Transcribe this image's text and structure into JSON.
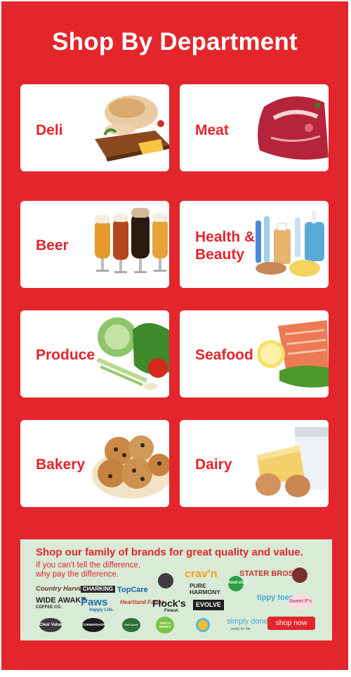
{
  "title": "Shop By Department",
  "departments": [
    {
      "label": "Deli",
      "icon": "deli-meat-icon"
    },
    {
      "label": "Meat",
      "icon": "steak-icon"
    },
    {
      "label": "Beer",
      "icon": "beer-glasses-icon"
    },
    {
      "label": "Health & Beauty",
      "icon": "toiletries-icon"
    },
    {
      "label": "Produce",
      "icon": "vegetables-icon"
    },
    {
      "label": "Seafood",
      "icon": "salmon-icon"
    },
    {
      "label": "Bakery",
      "icon": "cookies-icon"
    },
    {
      "label": "Dairy",
      "icon": "milk-cheese-eggs-icon"
    }
  ],
  "brands": {
    "headline": "Shop our family of brands for great quality and value.",
    "subtext": "If you can't tell the difference, why pay the difference.",
    "logos": {
      "country_harvest": "Country Harvest",
      "charking": "CHARKING",
      "topcare": "TopCare",
      "culinary_tours": "CULINARY TOURS",
      "cravn": "crav'n",
      "stater_bros": "STATER BROS.",
      "over_the_top": "over the top",
      "wide_awake": "WIDE AWAKE",
      "wide_awake_sub": "COFFEE CO.",
      "paws": "Paws",
      "paws_sub": "Happy Life.",
      "heartland": "Heartland Farms",
      "pure_harmony": "PURE HARMONY",
      "flocks": "Flock's",
      "flocks_sub": "Finest.",
      "evolve": "EVOLVE",
      "food_club": "food club",
      "tippy_toes": "tippy toes",
      "sweet_p": "Sweet P's",
      "clear_value": "Clear Value",
      "cornershop": "CORNERSHOP",
      "full_circle": "Full Circle",
      "thats_smart": "THAT'S SMART!",
      "simply_done": "simply done",
      "simply_done_sub": "ready for life"
    },
    "cta": "shop now"
  },
  "colors": {
    "brand_red": "#e2262c",
    "brand_band": "#d9ead7"
  }
}
